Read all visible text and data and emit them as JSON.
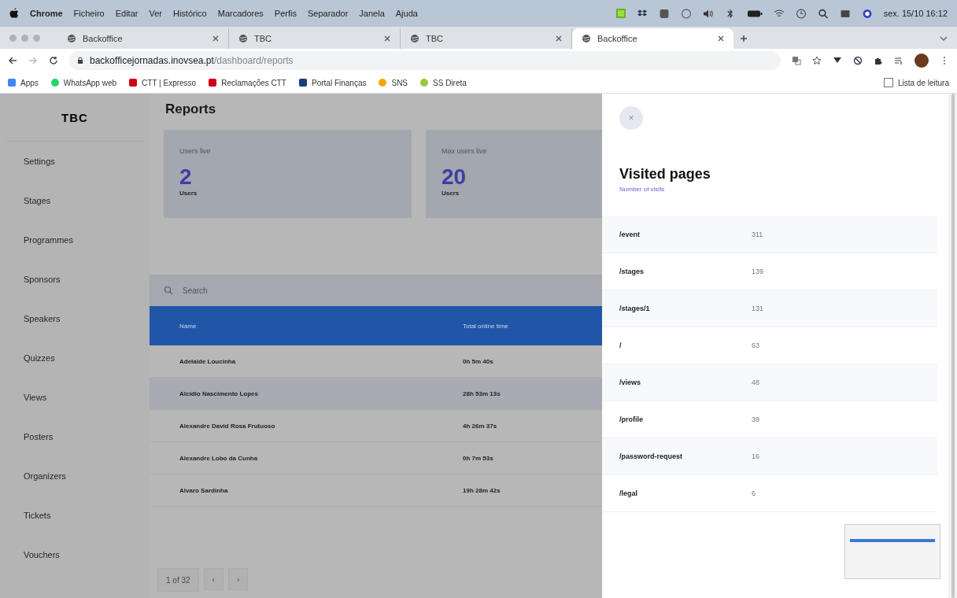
{
  "menu_bar": {
    "app": "Chrome",
    "items": [
      "Ficheiro",
      "Editar",
      "Ver",
      "Histórico",
      "Marcadores",
      "Perfis",
      "Separador",
      "Janela",
      "Ajuda"
    ],
    "clock": "sex. 15/10 16:12"
  },
  "browser_tabs": [
    {
      "title": "Backoffice",
      "selected": false
    },
    {
      "title": "TBC",
      "selected": false
    },
    {
      "title": "TBC",
      "selected": false
    },
    {
      "title": "Backoffice",
      "selected": true
    }
  ],
  "address_bar": {
    "host": "backofficejornadas.inovsea.pt",
    "path": "/dashboard/reports"
  },
  "bookmarks": [
    {
      "label": "Apps",
      "kind": "grid"
    },
    {
      "label": "WhatsApp web",
      "kind": "whatsapp"
    },
    {
      "label": "CTT | Expresso",
      "kind": "ctt"
    },
    {
      "label": "Reclamações CTT",
      "kind": "ctt"
    },
    {
      "label": "Portal Finanças",
      "kind": "finance"
    },
    {
      "label": "SNS",
      "kind": "sns"
    },
    {
      "label": "SS Direta",
      "kind": "ss"
    }
  ],
  "reading_list": "Lista de leitura",
  "sidebar": {
    "logo": "TBC",
    "items": [
      "Settings",
      "Stages",
      "Programmes",
      "Sponsors",
      "Speakers",
      "Quizzes",
      "Views",
      "Posters",
      "Organizers",
      "Tickets",
      "Vouchers"
    ]
  },
  "page": {
    "title": "Reports",
    "stats": [
      {
        "label": "Users live",
        "value": "2",
        "unit": "Users"
      },
      {
        "label": "Max users live",
        "value": "20",
        "unit": "Users"
      }
    ],
    "search": {
      "placeholder": "Search"
    },
    "table": {
      "columns": [
        "Name",
        "Total online time"
      ],
      "rows": [
        {
          "name": "Adelaide Loucinha",
          "time": "0h 5m 40s",
          "selected": false
        },
        {
          "name": "Alcídio Nascimento Lopes",
          "time": "28h 53m 13s",
          "selected": true
        },
        {
          "name": "Alexandre David Rosa Frutuoso",
          "time": "4h 26m 37s",
          "selected": false
        },
        {
          "name": "Alexandre Lobo da Cunha",
          "time": "0h 7m 53s",
          "selected": false
        },
        {
          "name": "Alvaro Sardinha",
          "time": "19h 28m 42s",
          "selected": false
        }
      ]
    },
    "pagination": {
      "label": "1 of 32",
      "prev": "‹",
      "next": "›"
    }
  },
  "drawer": {
    "close": "×",
    "title": "Visited pages",
    "subtitle": "Number of visits",
    "rows": [
      {
        "page": "/event",
        "visits": "311"
      },
      {
        "page": "/stages",
        "visits": "139"
      },
      {
        "page": "/stages/1",
        "visits": "131"
      },
      {
        "page": "/",
        "visits": "63"
      },
      {
        "page": "/views",
        "visits": "48"
      },
      {
        "page": "/profile",
        "visits": "39"
      },
      {
        "page": "/password-request",
        "visits": "16"
      },
      {
        "page": "/legal",
        "visits": "6"
      }
    ]
  }
}
